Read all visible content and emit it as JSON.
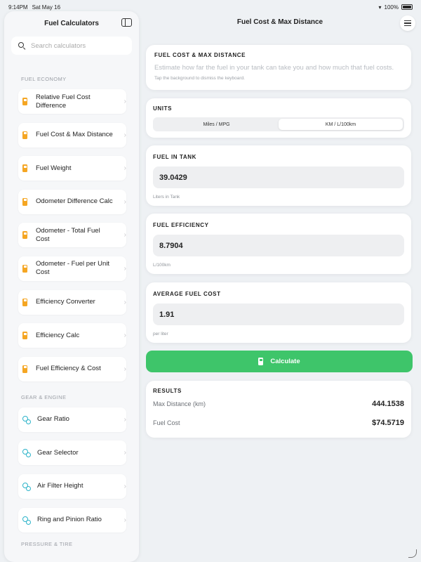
{
  "status": {
    "time": "9:14PM",
    "date": "Sat May 16",
    "battery": "100%"
  },
  "sidebar": {
    "title": "Fuel Calculators",
    "search_placeholder": "Search calculators",
    "sections": [
      {
        "label": "FUEL ECONOMY",
        "icon": "fuel-pump-icon",
        "items": [
          "Relative Fuel Cost Difference",
          "Fuel Cost & Max Distance",
          "Fuel Weight",
          "Odometer Difference Calc",
          "Odometer - Total Fuel Cost",
          "Odometer - Fuel per Unit Cost",
          "Efficiency Converter",
          "Efficiency Calc",
          "Fuel Efficiency & Cost"
        ]
      },
      {
        "label": "GEAR & ENGINE",
        "icon": "gears-icon",
        "items": [
          "Gear Ratio",
          "Gear Selector",
          "Air Filter Height",
          "Ring and Pinion Ratio"
        ]
      }
    ],
    "next_section_label": "PRESSURE & TIRE"
  },
  "main": {
    "title": "Fuel Cost & Max Distance",
    "intro": {
      "title": "FUEL COST & MAX DISTANCE",
      "description": "Estimate how far the fuel in your tank can take you and how much that fuel costs.",
      "hint": "Tap the background to dismiss the keyboard."
    },
    "units": {
      "title": "UNITS",
      "options": [
        "Miles / MPG",
        "KM / L/100km"
      ],
      "selected": "KM / L/100km"
    },
    "fuel_in_tank": {
      "title": "FUEL IN TANK",
      "value": "39.0429",
      "sub": "Liters in Tank"
    },
    "fuel_efficiency": {
      "title": "FUEL EFFICIENCY",
      "value": "8.7904",
      "sub": "L/100km"
    },
    "average_fuel_cost": {
      "title": "AVERAGE FUEL COST",
      "value": "1.91",
      "sub": "per liter"
    },
    "calculate_label": "Calculate",
    "results": {
      "title": "RESULTS",
      "rows": [
        {
          "label": "Max Distance (km)",
          "value": "444.1538"
        },
        {
          "label": "Fuel Cost",
          "value": "$74.5719"
        }
      ]
    }
  },
  "colors": {
    "accent_green": "#3ec56a",
    "fuel_icon": "#f5a623",
    "gear_icon": "#2bb3c9"
  }
}
